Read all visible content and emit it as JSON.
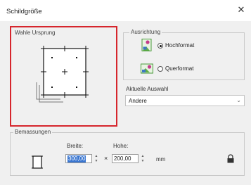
{
  "window": {
    "title": "Schildgröße",
    "close_glyph": "✕"
  },
  "origin": {
    "label": "Wahle Ursprung"
  },
  "orientation": {
    "label": "Ausrichtung",
    "portrait_label": "Hochformat",
    "landscape_label": "Querformat",
    "selected": "Hochformat"
  },
  "selection": {
    "label": "Aktuelle Auswahl",
    "value": "Andere",
    "arrow": "⌄"
  },
  "dimensions": {
    "label": "Bemassungen",
    "width_label": "Breite:",
    "height_label": "Hohe:",
    "width_value": "300,00",
    "height_value": "200,00",
    "times": "×",
    "unit": "mm",
    "spin_up": "▲",
    "spin_down": "▼"
  },
  "colors": {
    "highlight_border": "#d6262d",
    "text_selection": "#3a76d0"
  }
}
